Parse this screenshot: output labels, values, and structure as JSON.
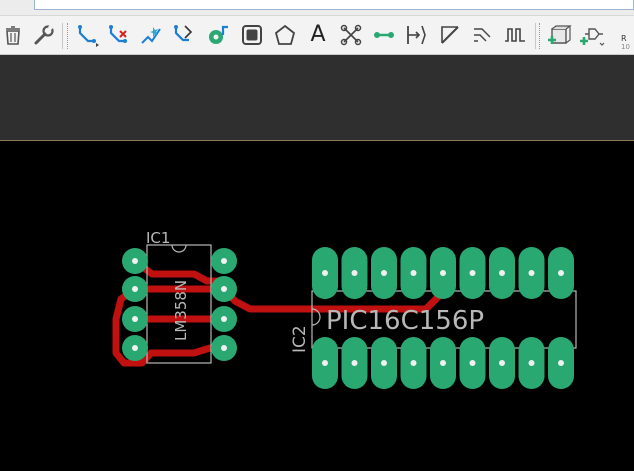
{
  "toolbar": {
    "tools": [
      {
        "name": "delete-tool",
        "icon": "trash-icon"
      },
      {
        "name": "wrench-tool",
        "icon": "wrench-icon"
      },
      {
        "name": "route-tool",
        "icon": "route-icon"
      },
      {
        "name": "ripup-tool",
        "icon": "ripup-icon"
      },
      {
        "name": "autoroute-tool",
        "icon": "autoroute-icon"
      },
      {
        "name": "optimize-tool",
        "icon": "optimize-icon"
      },
      {
        "name": "via-tool",
        "icon": "via-icon"
      },
      {
        "name": "rect-tool",
        "icon": "rectangle-icon"
      },
      {
        "name": "polygon-tool",
        "icon": "polygon-icon"
      },
      {
        "name": "text-tool",
        "icon": "text-icon"
      },
      {
        "name": "signal-tool",
        "icon": "signal-icon"
      },
      {
        "name": "wire-tool",
        "icon": "wire-icon"
      },
      {
        "name": "dimension-tool",
        "icon": "dimension-icon"
      },
      {
        "name": "line-tool",
        "icon": "line-icon"
      },
      {
        "name": "miter-tool",
        "icon": "miter-icon"
      },
      {
        "name": "meander-tool",
        "icon": "meander-icon"
      },
      {
        "name": "add-part-tool",
        "icon": "add-part-icon"
      },
      {
        "name": "add-component-tool",
        "icon": "add-component-icon"
      }
    ],
    "text_tool_glyph": "A",
    "right_label_top": "R",
    "right_label_bottom": "10"
  },
  "board": {
    "colors": {
      "pad": "#2aa872",
      "trace": "#c01010",
      "silk": "#b8b8b8",
      "background": "#000000"
    },
    "ic1": {
      "name": "IC1",
      "value": "LM358N",
      "pins": 8
    },
    "ic2": {
      "name": "IC2",
      "value": "PIC16C156P",
      "pins": 18
    }
  }
}
